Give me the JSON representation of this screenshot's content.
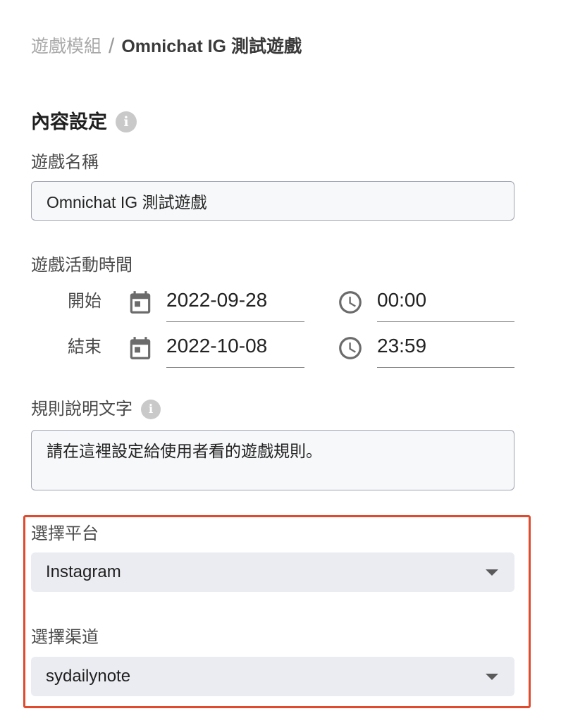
{
  "breadcrumb": {
    "parent": "遊戲模組",
    "separator": "/",
    "current": "Omnichat IG 測試遊戲"
  },
  "section": {
    "title": "內容設定",
    "info_icon": "i"
  },
  "game_name": {
    "label": "遊戲名稱",
    "value": "Omnichat IG 測試遊戲"
  },
  "activity_time": {
    "label": "遊戲活動時間",
    "start": {
      "label": "開始",
      "date": "2022-09-28",
      "time": "00:00"
    },
    "end": {
      "label": "結束",
      "date": "2022-10-08",
      "time": "23:59"
    }
  },
  "rules": {
    "label": "規則說明文字",
    "info_icon": "i",
    "value": "請在這裡設定給使用者看的遊戲規則。"
  },
  "platform": {
    "label": "選擇平台",
    "value": "Instagram"
  },
  "channel": {
    "label": "選擇渠道",
    "value": "sydailynote"
  },
  "colors": {
    "highlight_border": "#e04a2d",
    "icon_gray": "#6b6b6b",
    "select_background": "#ebecf1"
  }
}
